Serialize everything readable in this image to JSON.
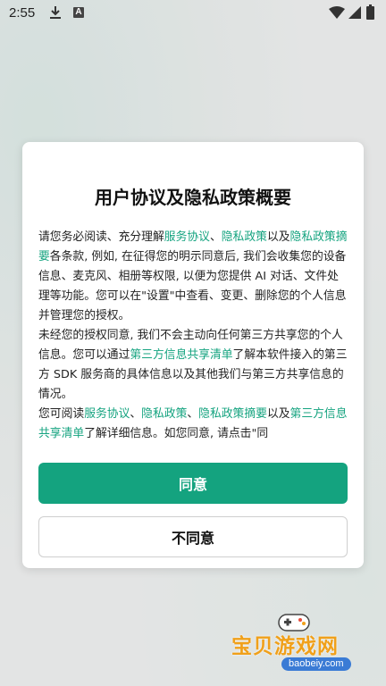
{
  "status_bar": {
    "time": "2:55",
    "icons": [
      "download-icon",
      "a-badge-icon",
      "wifi-icon",
      "signal-icon",
      "battery-icon"
    ],
    "a_badge": "A"
  },
  "dialog": {
    "title": "用户协议及隐私政策概要",
    "paragraph1": [
      {
        "text": "请您务必阅读、充分理解",
        "link": false
      },
      {
        "text": "服务协议",
        "link": true
      },
      {
        "text": "、",
        "link": false
      },
      {
        "text": "隐私政策",
        "link": true
      },
      {
        "text": "以及",
        "link": false
      },
      {
        "text": "隐私政策摘要",
        "link": true
      },
      {
        "text": "各条款, 例如, 在征得您的明示同意后, 我们会收集您的设备信息、麦克风、相册等权限, 以便为您提供 AI 对话、文件处理等功能。您可以在\"设置\"中查看、变更、删除您的个人信息并管理您的授权。",
        "link": false
      }
    ],
    "paragraph2": [
      {
        "text": "未经您的授权同意, 我们不会主动向任何第三方共享您的个人信息。您可以通过",
        "link": false
      },
      {
        "text": "第三方信息共享清单",
        "link": true
      },
      {
        "text": "了解本软件接入的第三方 SDK 服务商的具体信息以及其他我们与第三方共享信息的情况。",
        "link": false
      }
    ],
    "paragraph3": [
      {
        "text": "您可阅读",
        "link": false
      },
      {
        "text": "服务协议",
        "link": true
      },
      {
        "text": "、",
        "link": false
      },
      {
        "text": "隐私政策",
        "link": true
      },
      {
        "text": "、",
        "link": false
      },
      {
        "text": "隐私政策摘要",
        "link": true
      },
      {
        "text": "以及",
        "link": false
      },
      {
        "text": "第三方信息共享清单",
        "link": true
      },
      {
        "text": "了解详细信息。如您同意, 请点击\"同",
        "link": false
      }
    ],
    "agree_label": "同意",
    "disagree_label": "不同意"
  },
  "watermark": {
    "name": "宝贝游戏网",
    "url": "baobeiy.com"
  },
  "colors": {
    "accent": "#14a37f",
    "watermark": "#f0a01a"
  }
}
